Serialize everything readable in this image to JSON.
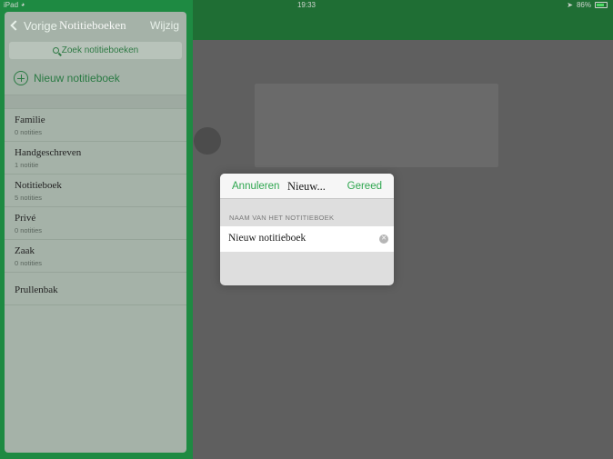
{
  "status_bar": {
    "carrier": "iPad",
    "time": "19:33",
    "battery": "86%",
    "battery_level": 0.86,
    "icons": [
      "wifi-icon",
      "location-arrow-icon",
      "battery-icon"
    ]
  },
  "sidebar": {
    "back_label": "Vorige",
    "title": "Notitieboeken",
    "edit_label": "Wijzig",
    "search_placeholder": "Zoek notitieboeken",
    "new_notebook_label": "Nieuw notitieboek",
    "notebooks": [
      {
        "name": "Familie",
        "count": "0 notities"
      },
      {
        "name": "Handgeschreven",
        "count": "1 notitie"
      },
      {
        "name": "Notitieboek",
        "count": "5 notities"
      },
      {
        "name": "Privé",
        "count": "0 notities"
      },
      {
        "name": "Zaak",
        "count": "0 notities"
      },
      {
        "name": "Prullenbak",
        "count": ""
      }
    ]
  },
  "dialog": {
    "cancel_label": "Annuleren",
    "title": "Nieuw...",
    "done_label": "Gereed",
    "field_label": "NAAM VAN HET NOTITIEBOEK",
    "field_value": "Nieuw notitieboek"
  },
  "colors": {
    "accent_green": "#2ea64f",
    "frame_green": "#1e8a42"
  }
}
